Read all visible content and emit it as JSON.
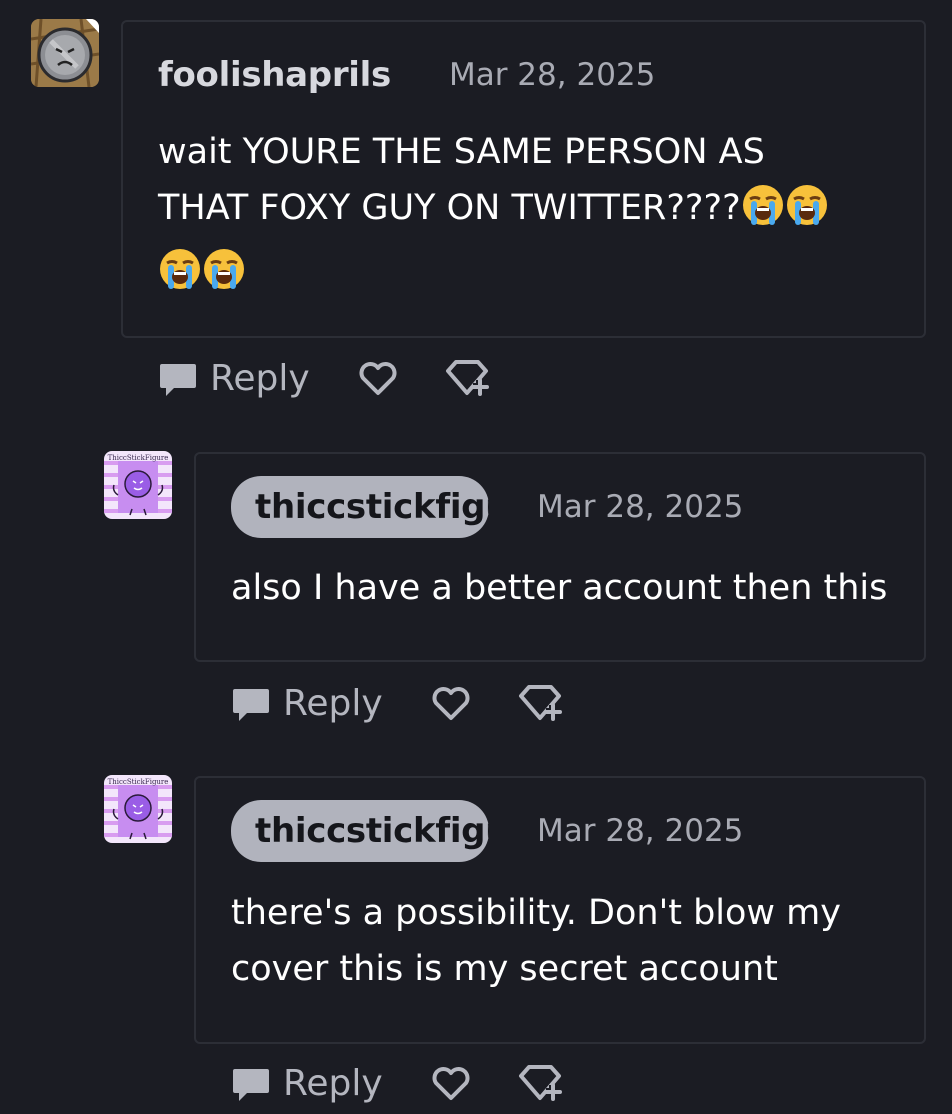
{
  "colors": {
    "background": "#1b1c23",
    "card_border": "#2c2e36",
    "username": "#d7d8de",
    "pill_bg": "#b1b3bd",
    "date": "#a9abb4",
    "action": "#b4b6bf"
  },
  "comments": [
    {
      "username": "foolishaprils",
      "date": "Mar 28, 2025",
      "text_line1": "wait YOURE THE SAME PERSON AS",
      "text_line2": "THAT FOXY GUY ON TWITTER????",
      "emoji": "loudly-crying-face",
      "emoji_count": 4,
      "reply_label": "Reply"
    },
    {
      "username": "thiccstickfigu",
      "date": "Mar 28, 2025",
      "text_line1": "also I have a better account then this",
      "reply_label": "Reply"
    },
    {
      "username": "thiccstickfigu",
      "date": "Mar 28, 2025",
      "text_line1": "there's a possibility. Don't blow my",
      "text_line2": "cover this is my secret account",
      "reply_label": "Reply"
    }
  ],
  "avatars": {
    "reply_avatar_label": "ThiccStickFigure"
  }
}
